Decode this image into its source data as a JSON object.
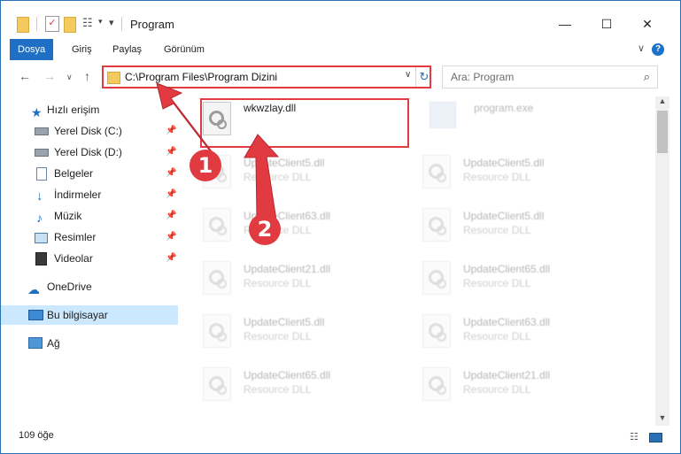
{
  "window": {
    "title": "Program"
  },
  "ribbon": {
    "tabs": [
      {
        "label": "Dosya",
        "active": true
      },
      {
        "label": "Giriş"
      },
      {
        "label": "Paylaş"
      },
      {
        "label": "Görünüm"
      }
    ],
    "help_label": "?"
  },
  "address": {
    "path": "C:\\Program Files\\Program Dizini",
    "search_placeholder": "Ara: Program"
  },
  "sidebar": {
    "items": [
      {
        "label": "Hızlı erişim",
        "icon": "star-icon"
      },
      {
        "label": "Yerel Disk (C:)",
        "icon": "drive-icon",
        "pinned": true
      },
      {
        "label": "Yerel Disk (D:)",
        "icon": "drive-icon",
        "pinned": true
      },
      {
        "label": "Belgeler",
        "icon": "documents-icon",
        "pinned": true
      },
      {
        "label": "İndirmeler",
        "icon": "download-icon",
        "pinned": true
      },
      {
        "label": "Müzik",
        "icon": "music-icon",
        "pinned": true
      },
      {
        "label": "Resimler",
        "icon": "pictures-icon",
        "pinned": true
      },
      {
        "label": "Videolar",
        "icon": "videos-icon",
        "pinned": true
      },
      {
        "label": "OneDrive",
        "icon": "cloud-icon"
      },
      {
        "label": "Bu bilgisayar",
        "icon": "computer-icon",
        "selected": true
      },
      {
        "label": "Ağ",
        "icon": "network-icon"
      }
    ]
  },
  "files": {
    "highlighted": {
      "name": "wkwzlay.dll"
    },
    "left": [
      {
        "name": "UpdateClient5.dll",
        "type": "Resource DLL"
      },
      {
        "name": "UpdateClient63.dll",
        "type": "Resource DLL"
      },
      {
        "name": "UpdateClient21.dll",
        "type": "Resource DLL"
      },
      {
        "name": "UpdateClient5.dll",
        "type": "Resource DLL"
      },
      {
        "name": "UpdateClient65.dll",
        "type": "Resource DLL"
      }
    ],
    "right_top": {
      "name": "program.exe"
    },
    "right": [
      {
        "name": "UpdateClient5.dll",
        "type": "Resource DLL"
      },
      {
        "name": "UpdateClient5.dll",
        "type": "Resource DLL"
      },
      {
        "name": "UpdateClient65.dll",
        "type": "Resource DLL"
      },
      {
        "name": "UpdateClient63.dll",
        "type": "Resource DLL"
      },
      {
        "name": "UpdateClient21.dll",
        "type": "Resource DLL"
      }
    ]
  },
  "status": {
    "count": "109 öğe"
  },
  "annotations": {
    "step1": "1",
    "step2": "2"
  },
  "colors": {
    "accent": "#1f6fc4",
    "highlight": "#e33b42",
    "selected": "#cce8ff"
  }
}
